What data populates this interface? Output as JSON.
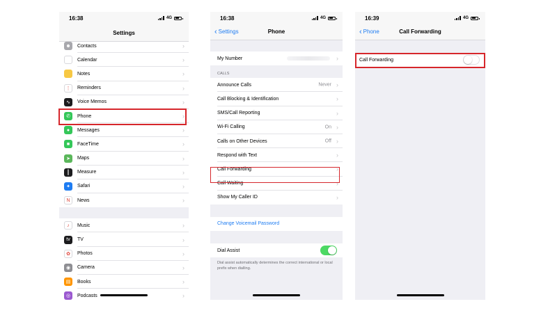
{
  "screen1": {
    "time": "16:38",
    "network": "4G",
    "title": "Settings",
    "group1": [
      {
        "label": "Contacts",
        "icon": "contacts-icon",
        "color": "#a8a8ad",
        "glyph": "☻"
      },
      {
        "label": "Calendar",
        "icon": "calendar-icon",
        "color": "#ffffff",
        "glyph": ""
      },
      {
        "label": "Notes",
        "icon": "notes-icon",
        "color": "#f7c844",
        "glyph": ""
      },
      {
        "label": "Reminders",
        "icon": "reminders-icon",
        "color": "#ffffff",
        "glyph": "⋮"
      },
      {
        "label": "Voice Memos",
        "icon": "voice-memos-icon",
        "color": "#1c1c1e",
        "glyph": "∿"
      },
      {
        "label": "Phone",
        "icon": "phone-icon",
        "color": "#34c759",
        "glyph": "✆"
      },
      {
        "label": "Messages",
        "icon": "messages-icon",
        "color": "#34c759",
        "glyph": "●"
      },
      {
        "label": "FaceTime",
        "icon": "facetime-icon",
        "color": "#34c759",
        "glyph": "■"
      },
      {
        "label": "Maps",
        "icon": "maps-icon",
        "color": "#5bb75b",
        "glyph": "➤"
      },
      {
        "label": "Measure",
        "icon": "measure-icon",
        "color": "#1c1c1e",
        "glyph": "┃"
      },
      {
        "label": "Safari",
        "icon": "safari-icon",
        "color": "#1e7cf2",
        "glyph": "✦"
      },
      {
        "label": "News",
        "icon": "news-icon",
        "color": "#ffffff",
        "glyph": "N"
      }
    ],
    "group2": [
      {
        "label": "Music",
        "icon": "music-icon",
        "color": "#ffffff",
        "glyph": "♪"
      },
      {
        "label": "TV",
        "icon": "tv-icon",
        "color": "#1c1c1e",
        "glyph": "tv"
      },
      {
        "label": "Photos",
        "icon": "photos-icon",
        "color": "#ffffff",
        "glyph": "✿"
      },
      {
        "label": "Camera",
        "icon": "camera-icon",
        "color": "#8e8e93",
        "glyph": "◉"
      },
      {
        "label": "Books",
        "icon": "books-icon",
        "color": "#ff9500",
        "glyph": "▤"
      },
      {
        "label": "Podcasts",
        "icon": "podcasts-icon",
        "color": "#9b59d0",
        "glyph": "◎"
      }
    ]
  },
  "screen2": {
    "time": "16:38",
    "network": "4G",
    "back_label": "Settings",
    "title": "Phone",
    "my_number_label": "My Number",
    "calls_header": "CALLS",
    "calls": [
      {
        "label": "Announce Calls",
        "value": "Never"
      },
      {
        "label": "Call Blocking & Identification",
        "value": ""
      },
      {
        "label": "SMS/Call Reporting",
        "value": ""
      },
      {
        "label": "Wi-Fi Calling",
        "value": "On"
      },
      {
        "label": "Calls on Other Devices",
        "value": "Off"
      },
      {
        "label": "Respond with Text",
        "value": ""
      },
      {
        "label": "Call Forwarding",
        "value": ""
      },
      {
        "label": "Call Waiting",
        "value": ""
      },
      {
        "label": "Show My Caller ID",
        "value": ""
      }
    ],
    "voicemail_link": "Change Voicemail Password",
    "dial_assist_label": "Dial Assist",
    "dial_assist_on": true,
    "dial_assist_footer": "Dial assist automatically determines the correct international or local prefix when dialling."
  },
  "screen3": {
    "time": "16:39",
    "network": "4G",
    "back_label": "Phone",
    "title": "Call Forwarding",
    "toggle_label": "Call Forwarding",
    "toggle_on": false
  },
  "colors": {
    "highlight": "#d6262b",
    "ios_blue": "#1e7cf2",
    "toggle_green": "#4cd964"
  }
}
